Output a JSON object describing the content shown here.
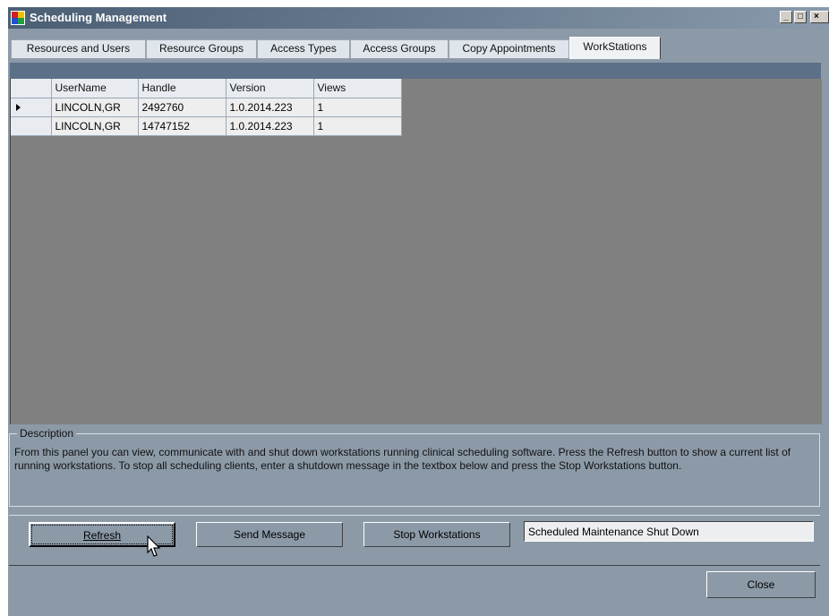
{
  "window": {
    "title": "Scheduling Management"
  },
  "tabs": [
    {
      "label": "Resources and Users"
    },
    {
      "label": "Resource Groups"
    },
    {
      "label": "Access Types"
    },
    {
      "label": "Access Groups"
    },
    {
      "label": "Copy Appointments"
    },
    {
      "label": "WorkStations",
      "active": true
    }
  ],
  "grid": {
    "columns": [
      "UserName",
      "Handle",
      "Version",
      "Views"
    ],
    "rows": [
      [
        "LINCOLN,GR",
        "2492760",
        "1.0.2014.223",
        "1"
      ],
      [
        "LINCOLN,GR",
        "14747152",
        "1.0.2014.223",
        "1"
      ]
    ],
    "selected_row": 0
  },
  "description": {
    "legend": "Description",
    "text": "From this panel you can view, communicate with and shut down workstations running clinical scheduling software.  Press the Refresh button to show a current list of running workstations.  To stop all scheduling clients, enter a shutdown message in the textbox below and press the Stop Workstations button."
  },
  "actions": {
    "refresh_label": "Refresh",
    "send_message_label": "Send Message",
    "stop_workstations_label": "Stop Workstations",
    "message_value": "Scheduled Maintenance Shut Down",
    "close_label": "Close"
  },
  "icons": {
    "app": "app-icon",
    "cursor": "mouse-pointer-icon",
    "row_selector": "row-selector-arrow-icon"
  },
  "colors": {
    "window_bg": "#8c9aa8",
    "grid_bg": "#808080",
    "title_gradient_start": "#4a5e74"
  }
}
